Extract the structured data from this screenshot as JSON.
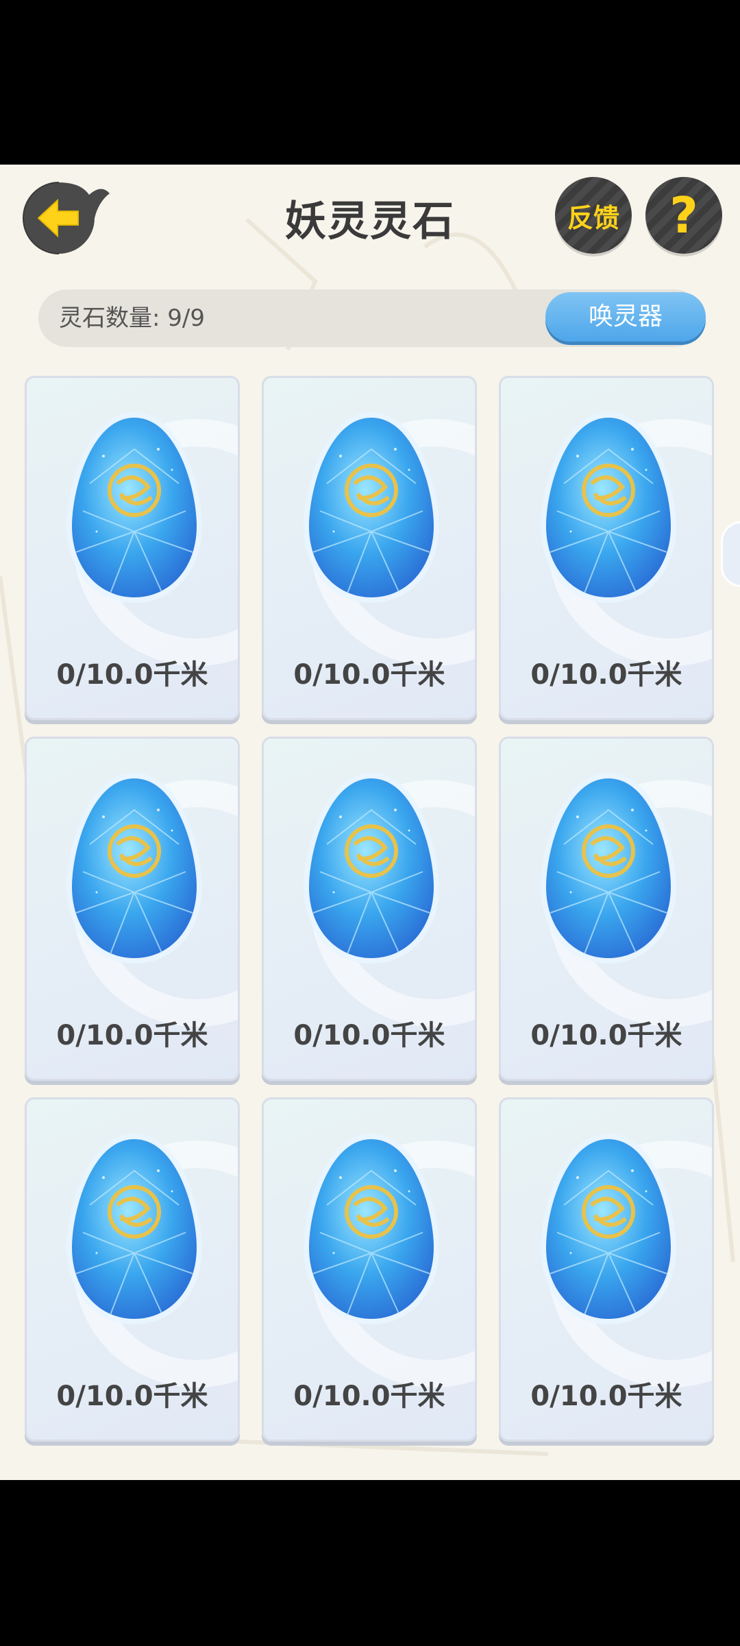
{
  "header": {
    "title": "妖灵灵石",
    "feedback_label": "反馈",
    "help_label": "?"
  },
  "count_bar": {
    "label": "灵石数量: 9/9",
    "summon_label": "唤灵器"
  },
  "stones": [
    {
      "distance": "0/10.0千米"
    },
    {
      "distance": "0/10.0千米"
    },
    {
      "distance": "0/10.0千米"
    },
    {
      "distance": "0/10.0千米"
    },
    {
      "distance": "0/10.0千米"
    },
    {
      "distance": "0/10.0千米"
    },
    {
      "distance": "0/10.0千米"
    },
    {
      "distance": "0/10.0千米"
    },
    {
      "distance": "0/10.0千米"
    }
  ],
  "icons": {
    "back": "back-arrow-icon",
    "stone": "spirit-stone-icon",
    "help": "question-mark-icon"
  },
  "colors": {
    "accent_yellow": "#ffd21a",
    "button_blue": "#4ea6ea",
    "dark_button": "#444444"
  }
}
